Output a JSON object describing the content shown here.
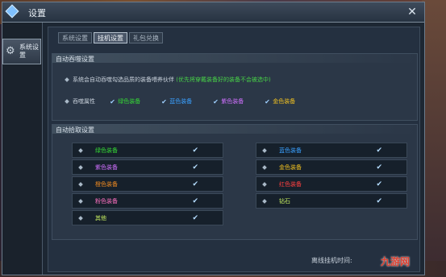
{
  "window": {
    "title": "设置"
  },
  "sidebar": {
    "active_tab": "系统设置"
  },
  "tabs": [
    {
      "label": "系统设置",
      "active": false
    },
    {
      "label": "挂机设置",
      "active": true
    },
    {
      "label": "礼包兑换",
      "active": false
    }
  ],
  "auto_feed": {
    "title": "自动吞噬设置",
    "description": "系统会自动吞噬勾选品质的装备喂养伙伴",
    "hint": "(优先将穿戴装备好的装备不会被选中)",
    "quality_label": "吞噬属性",
    "qualities": [
      {
        "label": "绿色装备",
        "color": "#35d835",
        "checked": true
      },
      {
        "label": "蓝色装备",
        "color": "#3aa0ff",
        "checked": true
      },
      {
        "label": "紫色装备",
        "color": "#d070ff",
        "checked": true
      },
      {
        "label": "金色装备",
        "color": "#f0c020",
        "checked": true
      }
    ]
  },
  "auto_pickup": {
    "title": "自动拾取设置",
    "left": [
      {
        "label": "绿色装备",
        "color": "#35d835",
        "checked": true
      },
      {
        "label": "紫色装备",
        "color": "#d070ff",
        "checked": true
      },
      {
        "label": "橙色装备",
        "color": "#f08a20",
        "checked": true
      },
      {
        "label": "粉色装备",
        "color": "#ff70c0",
        "checked": true
      },
      {
        "label": "其他",
        "color": "#c8f060",
        "checked": true
      }
    ],
    "right": [
      {
        "label": "蓝色装备",
        "color": "#3aa0ff",
        "checked": true
      },
      {
        "label": "金色装备",
        "color": "#f0c020",
        "checked": true
      },
      {
        "label": "红色装备",
        "color": "#ff4040",
        "checked": true
      },
      {
        "label": "钻石",
        "color": "#c8f060",
        "checked": true
      }
    ]
  },
  "footer": {
    "offline_label": "离线挂机时间:"
  },
  "watermark": "九游网"
}
